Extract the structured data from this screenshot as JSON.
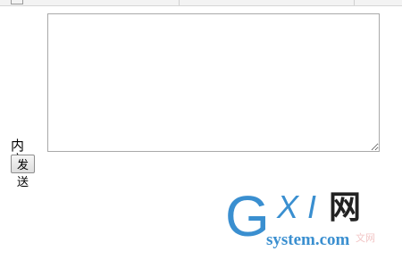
{
  "form": {
    "content_label": "内容",
    "content_value": "",
    "send_label": "发送"
  },
  "watermark": {
    "g": "G",
    "xi": "XI",
    "wang": "网",
    "system": "system.com",
    "faint": "文网"
  },
  "colors": {
    "brand_blue": "#3a8fd0",
    "textarea_border": "#a9a9a9"
  }
}
